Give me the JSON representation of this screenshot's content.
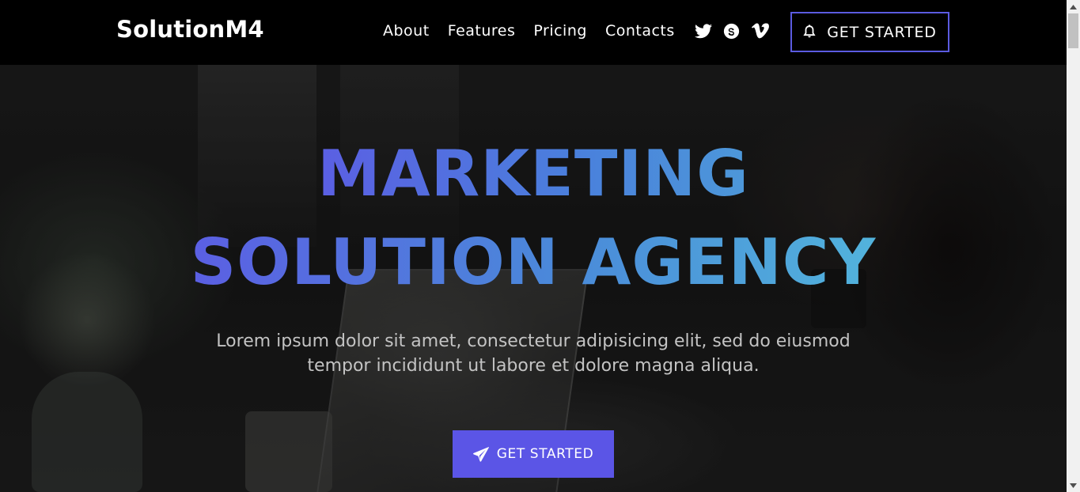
{
  "nav": {
    "brand": "SolutionM4",
    "links": [
      "About",
      "Features",
      "Pricing",
      "Contacts"
    ],
    "social_icons": [
      "twitter-icon",
      "skype-icon",
      "vimeo-icon"
    ],
    "cta_label": "GET STARTED",
    "cta_icon": "bell-icon",
    "cta_border_color": "#5b5be0"
  },
  "hero": {
    "title_line1": "MARKETING",
    "title_line2": "SOLUTION AGENCY",
    "gradient_colors": [
      "#5b5fe3",
      "#4a8ad9",
      "#52b3dc"
    ],
    "subtitle": "Lorem ipsum dolor sit amet, consectetur adipisicing elit, sed do eiusmod tempor incididunt ut labore et dolore magna aliqua.",
    "cta_label": "GET STARTED",
    "cta_icon": "paper-plane-icon",
    "cta_color": "#5b55e6"
  }
}
